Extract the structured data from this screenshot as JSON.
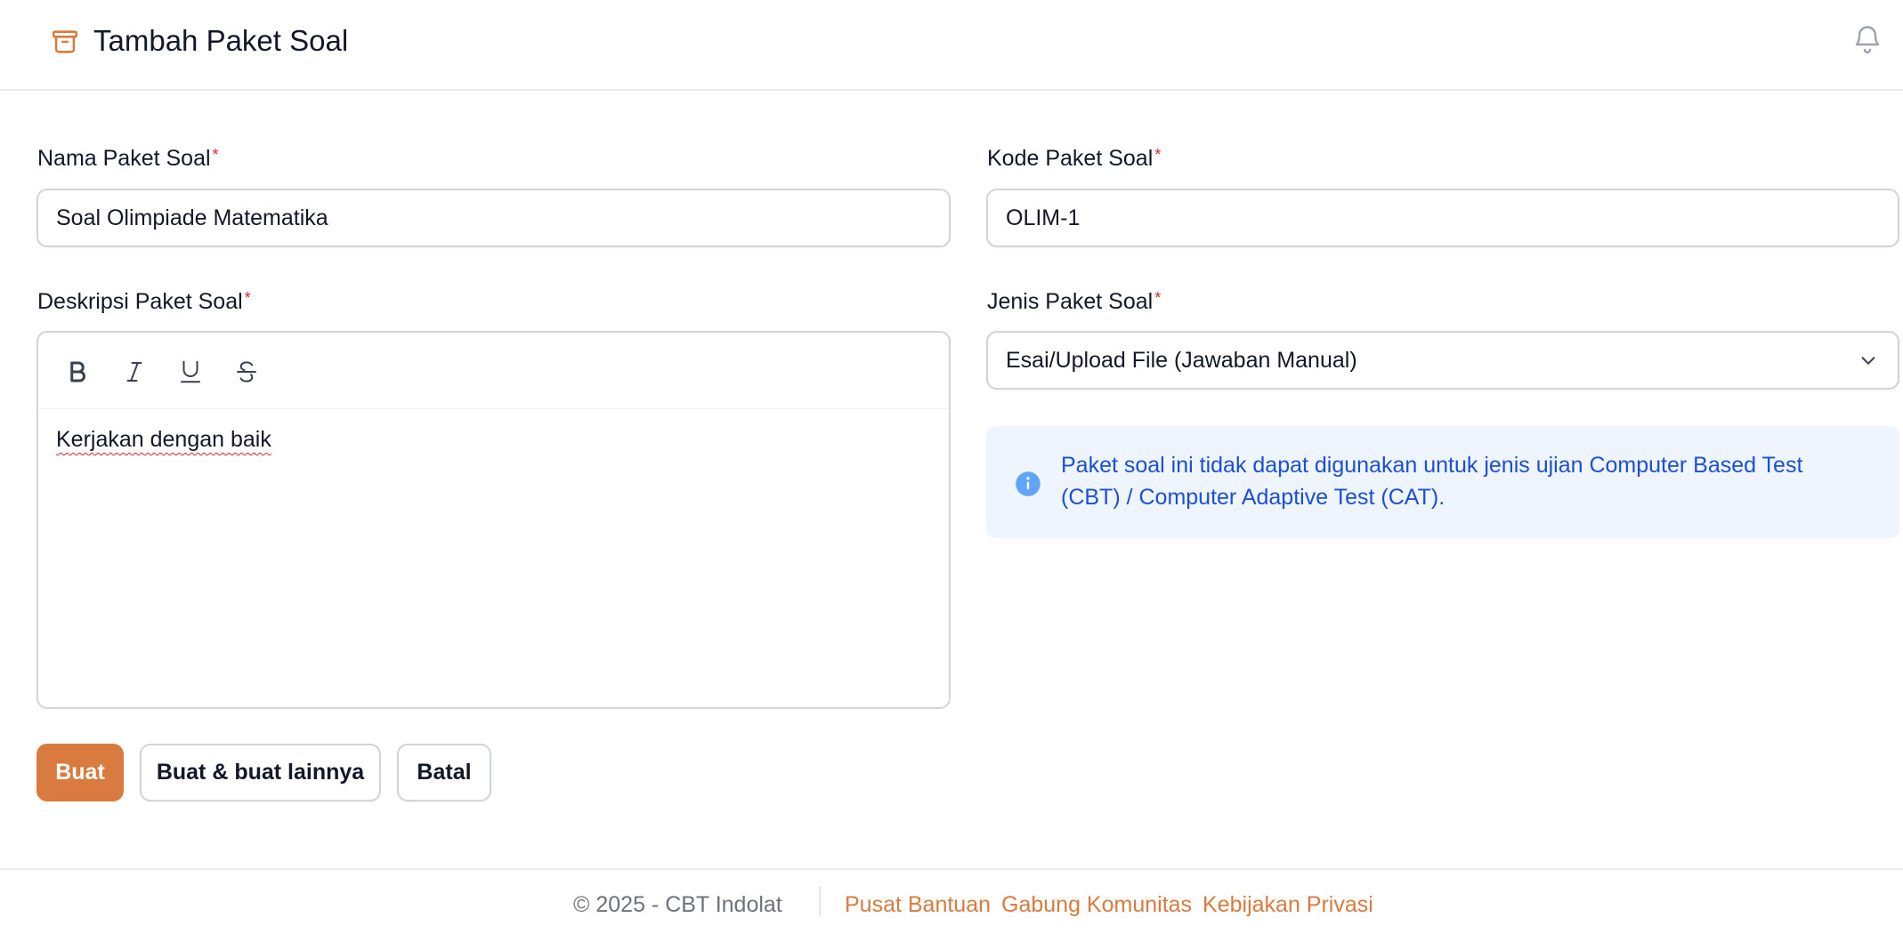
{
  "header": {
    "title": "Tambah Paket Soal",
    "icon": "archive-box-icon",
    "notification_icon": "bell-icon"
  },
  "form": {
    "nama": {
      "label": "Nama Paket Soal",
      "required_mark": "*",
      "value": "Soal Olimpiade Matematika"
    },
    "kode": {
      "label": "Kode Paket Soal",
      "required_mark": "*",
      "value": "OLIM-1"
    },
    "deskripsi": {
      "label": "Deskripsi Paket Soal",
      "required_mark": "*",
      "toolbar": [
        "bold-icon",
        "italic-icon",
        "underline-icon",
        "strikethrough-icon"
      ],
      "value": "Kerjakan dengan baik"
    },
    "jenis": {
      "label": "Jenis Paket Soal",
      "required_mark": "*",
      "selected": "Esai/Upload File (Jawaban Manual)"
    },
    "info": {
      "icon": "info-circle-icon",
      "text": "Paket soal ini tidak dapat digunakan untuk jenis ujian Computer Based Test (CBT) / Computer Adaptive Test (CAT)."
    }
  },
  "actions": {
    "create": "Buat",
    "create_another": "Buat & buat lainnya",
    "cancel": "Batal"
  },
  "footer": {
    "copyright": "© 2025 - CBT Indolat",
    "links": [
      "Pusat Bantuan",
      "Gabung Komunitas",
      "Kebijakan Privasi"
    ]
  },
  "colors": {
    "accent": "#d97b3e",
    "required": "#dc2626",
    "info_bg": "#eef5fe",
    "info_text": "#1d4ed8"
  }
}
